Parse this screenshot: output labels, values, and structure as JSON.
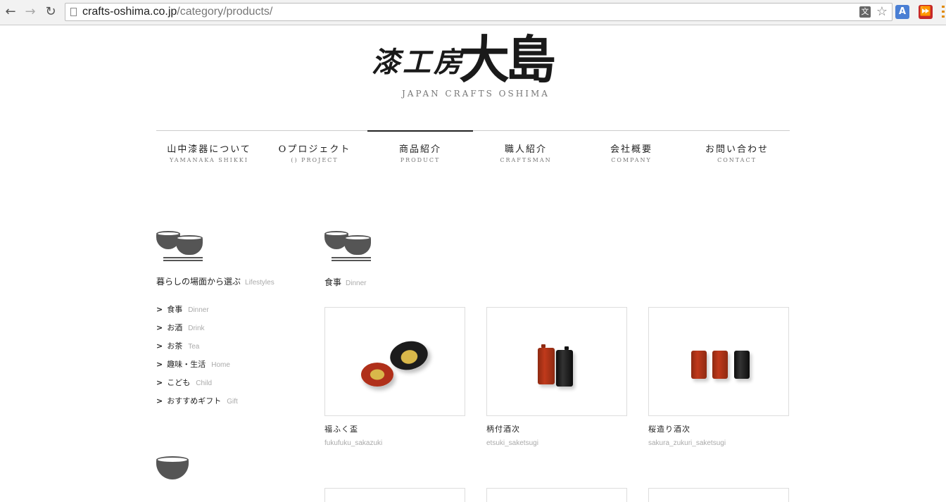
{
  "browser": {
    "url_host": "crafts-oshima.co.jp",
    "url_path": "/category/products/",
    "icons": [
      "back-icon",
      "forward-icon",
      "reload-icon",
      "page-icon",
      "translate-icon",
      "star-icon",
      "google-translate-icon",
      "media-extension-icon",
      "menu-icon"
    ]
  },
  "header": {
    "logo_jp": "漆工房大島",
    "brand_en": "JAPAN CRAFTS OSHIMA"
  },
  "nav": [
    {
      "jp": "山中漆器について",
      "en": "YAMANAKA SHIKKI",
      "active": false
    },
    {
      "jp": "Oプロジェクト",
      "en": "() PROJECT",
      "active": false
    },
    {
      "jp": "商品紹介",
      "en": "PRODUCT",
      "active": true
    },
    {
      "jp": "職人紹介",
      "en": "CRAFTSMAN",
      "active": false
    },
    {
      "jp": "会社概要",
      "en": "COMPANY",
      "active": false
    },
    {
      "jp": "お問い合わせ",
      "en": "CONTACT",
      "active": false
    }
  ],
  "sidebar": {
    "heading_jp": "暮らしの場面から選ぶ",
    "heading_en": "Lifestyles",
    "items": [
      {
        "jp": "食事",
        "en": "Dinner"
      },
      {
        "jp": "お酒",
        "en": "Drink"
      },
      {
        "jp": "お茶",
        "en": "Tea"
      },
      {
        "jp": "趣味・生活",
        "en": "Home"
      },
      {
        "jp": "こども",
        "en": "Child"
      },
      {
        "jp": "おすすめギフト",
        "en": "Gift"
      }
    ],
    "arrow": ">"
  },
  "category": {
    "jp": "食事",
    "en": "Dinner"
  },
  "products": [
    {
      "name": "福ふく盃",
      "code": "fukufuku_sakazuki"
    },
    {
      "name": "柄付酒次",
      "code": "etsuki_saketsugi"
    },
    {
      "name": "桜造り酒次",
      "code": "sakura_zukuri_saketsugi"
    }
  ],
  "colors": {
    "lacquer_red": "#c0391b",
    "lacquer_black": "#1c1c1c",
    "gold": "#d9b84a",
    "icon_gray": "#555555"
  }
}
